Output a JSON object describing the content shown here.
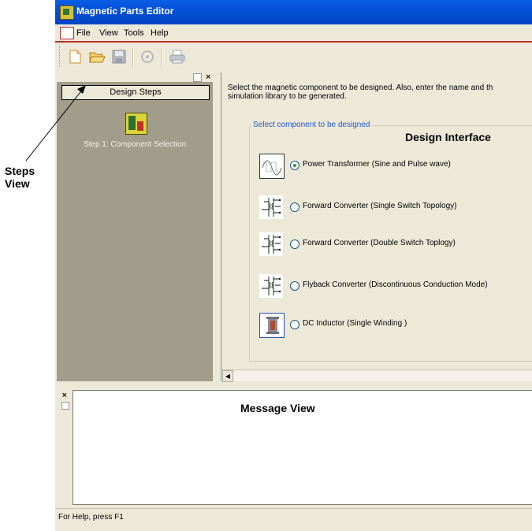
{
  "window": {
    "title": "Magnetic Parts Editor"
  },
  "menu": {
    "items": [
      "File",
      "View",
      "Tools",
      "Help"
    ]
  },
  "toolbar": {
    "buttons": [
      "new-icon",
      "open-icon",
      "save-icon",
      "refresh-icon",
      "print-icon"
    ]
  },
  "steps_panel": {
    "header_button": "Design Steps",
    "steps": [
      {
        "label": "Step 1: Component Selection",
        "icon": "component-selection-icon"
      }
    ]
  },
  "main": {
    "intro_line1": "Select the magnetic component to be designed. Also, enter the name and th",
    "intro_line2": "simulation library to be generated.",
    "group_label": "Select component to be designed",
    "options": [
      {
        "label": "Power Transformer (Sine and Pulse wave)",
        "selected": true,
        "icon": "sine-wave-icon"
      },
      {
        "label": "Forward Converter (Single Switch Topology)",
        "selected": false,
        "icon": "circuit-icon"
      },
      {
        "label": "Forward Converter (Double Switch Toplogy)",
        "selected": false,
        "icon": "circuit-icon"
      },
      {
        "label": "Flyback Converter (Discontinuous Conduction Mode)",
        "selected": false,
        "icon": "circuit-icon"
      },
      {
        "label": "DC Inductor (Single Winding )",
        "selected": false,
        "icon": "inductor-icon"
      }
    ]
  },
  "annotations": {
    "design_interface": "Design Interface",
    "message_view": "Message View",
    "steps_view_line1": "Steps",
    "steps_view_line2": "View"
  },
  "statusbar": {
    "text": "For Help, press F1"
  },
  "colors": {
    "title_bar": "#0350d6",
    "menu_underline": "#c0302a",
    "steps_bg": "#a29d8b",
    "window_bg": "#ece9d8",
    "group_label": "#2456c9",
    "radio_selected": "#21a121"
  }
}
